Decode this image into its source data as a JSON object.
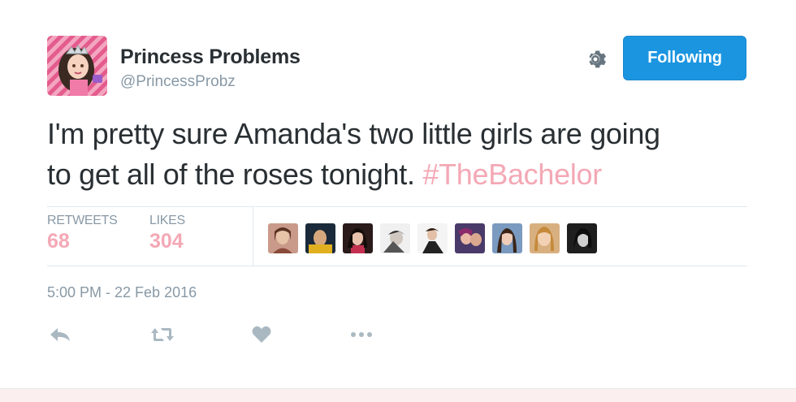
{
  "user": {
    "name": "Princess Problems",
    "handle": "@PrincessProbz",
    "avatar_icon": "princess-avatar"
  },
  "header": {
    "settings_icon": "gear-icon",
    "follow_label": "Following"
  },
  "tweet": {
    "text_line1": "I'm pretty sure Amanda's two little girls are going",
    "text_line2": "to get all of the roses tonight.",
    "hashtag": "#TheBachelor"
  },
  "stats": {
    "retweets_label": "RETWEETS",
    "retweets_count": "68",
    "likes_label": "LIKES",
    "likes_count": "304",
    "liker_avatars_count": 9
  },
  "timestamp": "5:00 PM - 22 Feb 2016",
  "actions": [
    "reply-icon",
    "retweet-icon",
    "like-icon",
    "more-icon"
  ],
  "colors": {
    "accent_blue": "#1b95e0",
    "hashtag_pink": "#f4a8b5",
    "muted_gray": "#8899a6",
    "text_dark": "#292f33"
  }
}
